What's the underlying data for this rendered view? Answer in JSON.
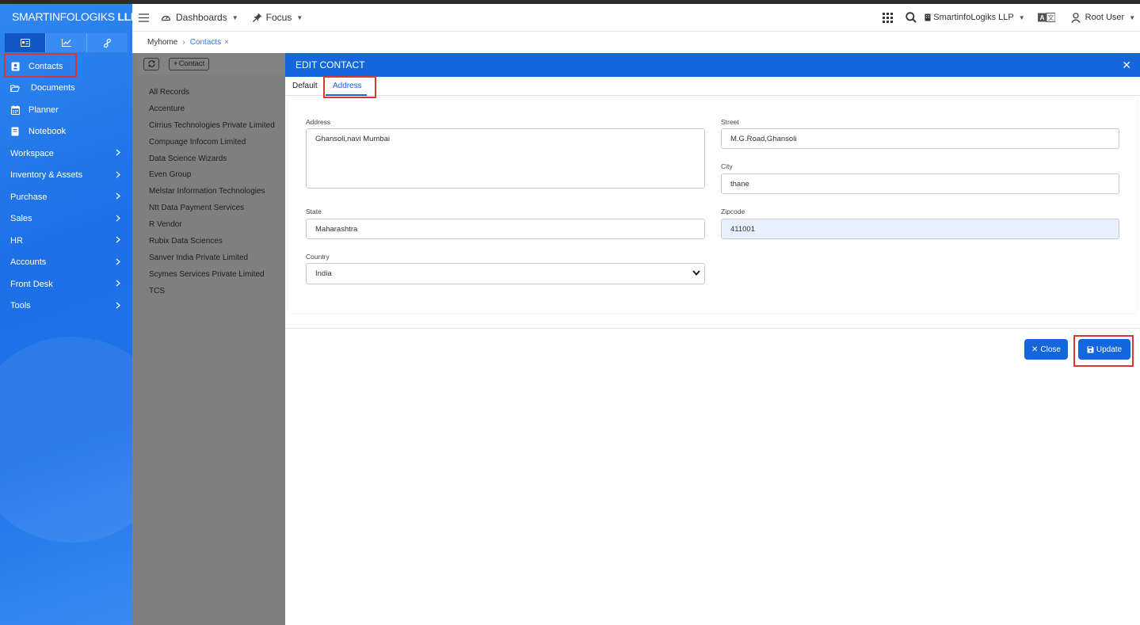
{
  "brand": {
    "light": "SMARTINFOLOGIKS",
    "bold": "LLP"
  },
  "sidebar": {
    "tab_icons": [
      "card-icon",
      "chart-icon",
      "link-icon"
    ],
    "items": [
      {
        "label": "Contacts",
        "icon": "contact-icon"
      },
      {
        "label": "Documents",
        "icon": "folder-icon"
      },
      {
        "label": "Planner",
        "icon": "calendar-icon"
      },
      {
        "label": "Notebook",
        "icon": "notebook-icon"
      },
      {
        "label": "Workspace"
      },
      {
        "label": "Inventory & Assets"
      },
      {
        "label": "Purchase"
      },
      {
        "label": "Sales"
      },
      {
        "label": "HR"
      },
      {
        "label": "Accounts"
      },
      {
        "label": "Front Desk"
      },
      {
        "label": "Tools"
      }
    ]
  },
  "topbar": {
    "dashboards": "Dashboards",
    "focus": "Focus",
    "company": "SmartinfoLogiks LLP",
    "user": "Root User"
  },
  "breadcrumb": {
    "home": "Myhome",
    "current": "Contacts"
  },
  "list": {
    "add_label": "Contact",
    "records": [
      "All Records",
      "Accenture",
      "Cirrius Technologies Private Limited",
      "Compuage Infocom Limited",
      "Data Science Wizards",
      "Even Group",
      "Melstar Information Technologies",
      "Ntt Data Payment Services",
      "R Vendor",
      "Rubix Data Sciences",
      "Sanver India Private Limited",
      "Scymes Services Private Limited",
      "TCS"
    ]
  },
  "modal": {
    "title": "EDIT CONTACT",
    "tabs": [
      "Default",
      "Address"
    ],
    "fields": {
      "address": {
        "label": "Address",
        "value": "Ghansoli,navi Mumbai"
      },
      "street": {
        "label": "Street",
        "value": "M.G.Road,Ghansoli"
      },
      "city": {
        "label": "City",
        "value": "thane"
      },
      "state": {
        "label": "State",
        "value": "Maharashtra"
      },
      "zipcode": {
        "label": "Zipcode",
        "value": "411001"
      },
      "country": {
        "label": "Country",
        "value": "India"
      }
    },
    "close_label": "Close",
    "update_label": "Update"
  },
  "colors": {
    "accent": "#1466dc",
    "highlight": "#d63838",
    "sidebar": "#1d6fe6",
    "overlay": "#7f7f7f"
  }
}
